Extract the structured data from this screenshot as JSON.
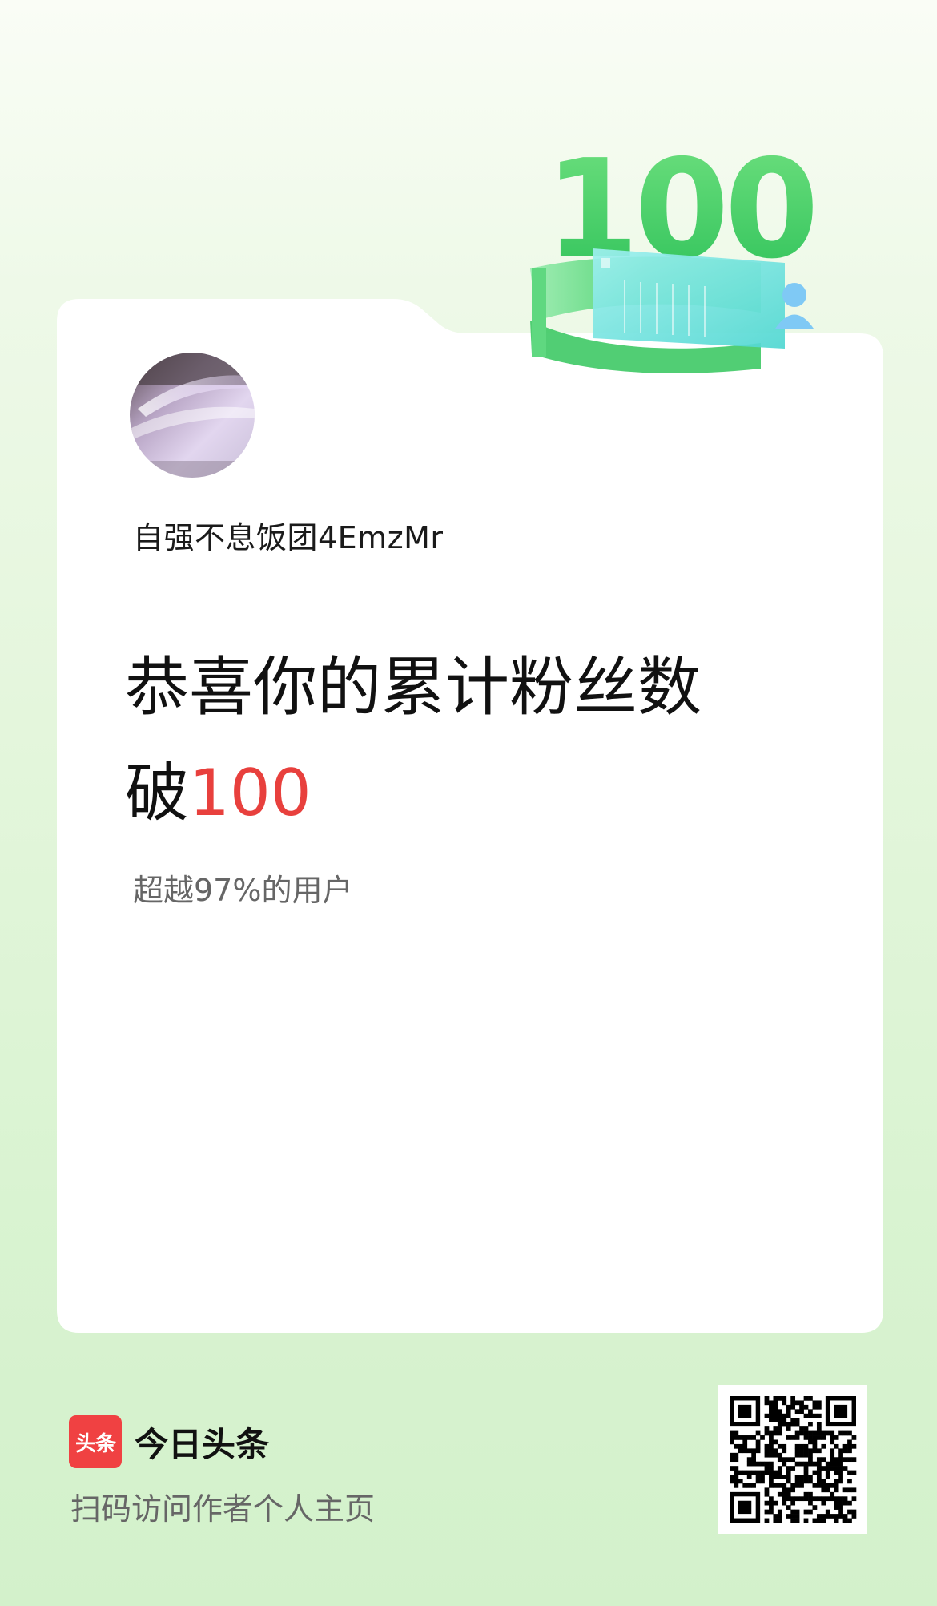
{
  "badge": {
    "number": "100"
  },
  "profile": {
    "username": "自强不息饭团4EmzMr"
  },
  "headline": {
    "line1": "恭喜你的累计粉丝数",
    "prefix": "破",
    "number": "100"
  },
  "surpass_text": "超越97%的用户",
  "footer": {
    "logo_text": "头条",
    "app_name": "今日头条",
    "hint": "扫码访问作者个人主页"
  },
  "colors": {
    "accent": "#e8403d",
    "brand": "#f04142",
    "badge_green": "#3ec965",
    "badge_cyan": "#6fe2e0"
  },
  "icons": [
    "avatar-image",
    "toutiao-logo-icon",
    "qr-code",
    "milestone-badge-illustration",
    "user-icon"
  ]
}
